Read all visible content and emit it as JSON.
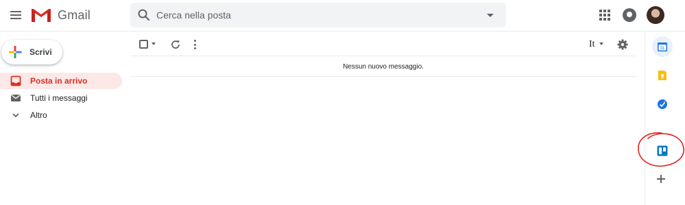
{
  "header": {
    "app_name": "Gmail",
    "search": {
      "placeholder": "Cerca nella posta",
      "value": ""
    }
  },
  "compose": {
    "label": "Scrivi"
  },
  "nav": {
    "items": [
      {
        "label": "Posta in arrivo",
        "icon": "inbox-icon",
        "active": true
      },
      {
        "label": "Tutti i messaggi",
        "icon": "mail-icon",
        "active": false
      },
      {
        "label": "Altro",
        "icon": "chevron-down-icon",
        "active": false
      }
    ]
  },
  "toolbar": {
    "language": "It"
  },
  "main": {
    "empty_message": "Nessun nuovo messaggio."
  },
  "side_panel": {
    "icons": [
      "calendar-icon",
      "keep-icon",
      "tasks-icon",
      "trello-icon",
      "add-icon"
    ],
    "calendar_day": "31"
  },
  "colors": {
    "active_nav_bg": "#fce8e6",
    "active_nav_text": "#d93025",
    "annotation_circle": "#e0201a",
    "calendar_blue": "#1a73e8",
    "keep_yellow": "#fbbc04",
    "trello_blue": "#0079bf"
  }
}
